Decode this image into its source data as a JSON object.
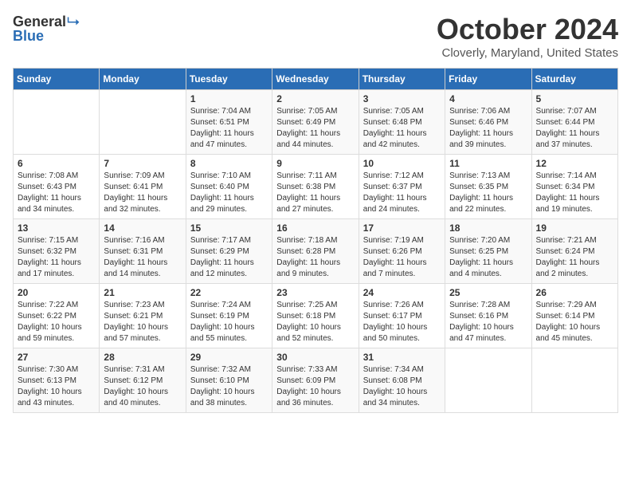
{
  "header": {
    "logo_general": "General",
    "logo_blue": "Blue",
    "month_title": "October 2024",
    "location": "Cloverly, Maryland, United States"
  },
  "weekdays": [
    "Sunday",
    "Monday",
    "Tuesday",
    "Wednesday",
    "Thursday",
    "Friday",
    "Saturday"
  ],
  "weeks": [
    [
      {
        "day": "",
        "sunrise": "",
        "sunset": "",
        "daylight": ""
      },
      {
        "day": "",
        "sunrise": "",
        "sunset": "",
        "daylight": ""
      },
      {
        "day": "1",
        "sunrise": "Sunrise: 7:04 AM",
        "sunset": "Sunset: 6:51 PM",
        "daylight": "Daylight: 11 hours and 47 minutes."
      },
      {
        "day": "2",
        "sunrise": "Sunrise: 7:05 AM",
        "sunset": "Sunset: 6:49 PM",
        "daylight": "Daylight: 11 hours and 44 minutes."
      },
      {
        "day": "3",
        "sunrise": "Sunrise: 7:05 AM",
        "sunset": "Sunset: 6:48 PM",
        "daylight": "Daylight: 11 hours and 42 minutes."
      },
      {
        "day": "4",
        "sunrise": "Sunrise: 7:06 AM",
        "sunset": "Sunset: 6:46 PM",
        "daylight": "Daylight: 11 hours and 39 minutes."
      },
      {
        "day": "5",
        "sunrise": "Sunrise: 7:07 AM",
        "sunset": "Sunset: 6:44 PM",
        "daylight": "Daylight: 11 hours and 37 minutes."
      }
    ],
    [
      {
        "day": "6",
        "sunrise": "Sunrise: 7:08 AM",
        "sunset": "Sunset: 6:43 PM",
        "daylight": "Daylight: 11 hours and 34 minutes."
      },
      {
        "day": "7",
        "sunrise": "Sunrise: 7:09 AM",
        "sunset": "Sunset: 6:41 PM",
        "daylight": "Daylight: 11 hours and 32 minutes."
      },
      {
        "day": "8",
        "sunrise": "Sunrise: 7:10 AM",
        "sunset": "Sunset: 6:40 PM",
        "daylight": "Daylight: 11 hours and 29 minutes."
      },
      {
        "day": "9",
        "sunrise": "Sunrise: 7:11 AM",
        "sunset": "Sunset: 6:38 PM",
        "daylight": "Daylight: 11 hours and 27 minutes."
      },
      {
        "day": "10",
        "sunrise": "Sunrise: 7:12 AM",
        "sunset": "Sunset: 6:37 PM",
        "daylight": "Daylight: 11 hours and 24 minutes."
      },
      {
        "day": "11",
        "sunrise": "Sunrise: 7:13 AM",
        "sunset": "Sunset: 6:35 PM",
        "daylight": "Daylight: 11 hours and 22 minutes."
      },
      {
        "day": "12",
        "sunrise": "Sunrise: 7:14 AM",
        "sunset": "Sunset: 6:34 PM",
        "daylight": "Daylight: 11 hours and 19 minutes."
      }
    ],
    [
      {
        "day": "13",
        "sunrise": "Sunrise: 7:15 AM",
        "sunset": "Sunset: 6:32 PM",
        "daylight": "Daylight: 11 hours and 17 minutes."
      },
      {
        "day": "14",
        "sunrise": "Sunrise: 7:16 AM",
        "sunset": "Sunset: 6:31 PM",
        "daylight": "Daylight: 11 hours and 14 minutes."
      },
      {
        "day": "15",
        "sunrise": "Sunrise: 7:17 AM",
        "sunset": "Sunset: 6:29 PM",
        "daylight": "Daylight: 11 hours and 12 minutes."
      },
      {
        "day": "16",
        "sunrise": "Sunrise: 7:18 AM",
        "sunset": "Sunset: 6:28 PM",
        "daylight": "Daylight: 11 hours and 9 minutes."
      },
      {
        "day": "17",
        "sunrise": "Sunrise: 7:19 AM",
        "sunset": "Sunset: 6:26 PM",
        "daylight": "Daylight: 11 hours and 7 minutes."
      },
      {
        "day": "18",
        "sunrise": "Sunrise: 7:20 AM",
        "sunset": "Sunset: 6:25 PM",
        "daylight": "Daylight: 11 hours and 4 minutes."
      },
      {
        "day": "19",
        "sunrise": "Sunrise: 7:21 AM",
        "sunset": "Sunset: 6:24 PM",
        "daylight": "Daylight: 11 hours and 2 minutes."
      }
    ],
    [
      {
        "day": "20",
        "sunrise": "Sunrise: 7:22 AM",
        "sunset": "Sunset: 6:22 PM",
        "daylight": "Daylight: 10 hours and 59 minutes."
      },
      {
        "day": "21",
        "sunrise": "Sunrise: 7:23 AM",
        "sunset": "Sunset: 6:21 PM",
        "daylight": "Daylight: 10 hours and 57 minutes."
      },
      {
        "day": "22",
        "sunrise": "Sunrise: 7:24 AM",
        "sunset": "Sunset: 6:19 PM",
        "daylight": "Daylight: 10 hours and 55 minutes."
      },
      {
        "day": "23",
        "sunrise": "Sunrise: 7:25 AM",
        "sunset": "Sunset: 6:18 PM",
        "daylight": "Daylight: 10 hours and 52 minutes."
      },
      {
        "day": "24",
        "sunrise": "Sunrise: 7:26 AM",
        "sunset": "Sunset: 6:17 PM",
        "daylight": "Daylight: 10 hours and 50 minutes."
      },
      {
        "day": "25",
        "sunrise": "Sunrise: 7:28 AM",
        "sunset": "Sunset: 6:16 PM",
        "daylight": "Daylight: 10 hours and 47 minutes."
      },
      {
        "day": "26",
        "sunrise": "Sunrise: 7:29 AM",
        "sunset": "Sunset: 6:14 PM",
        "daylight": "Daylight: 10 hours and 45 minutes."
      }
    ],
    [
      {
        "day": "27",
        "sunrise": "Sunrise: 7:30 AM",
        "sunset": "Sunset: 6:13 PM",
        "daylight": "Daylight: 10 hours and 43 minutes."
      },
      {
        "day": "28",
        "sunrise": "Sunrise: 7:31 AM",
        "sunset": "Sunset: 6:12 PM",
        "daylight": "Daylight: 10 hours and 40 minutes."
      },
      {
        "day": "29",
        "sunrise": "Sunrise: 7:32 AM",
        "sunset": "Sunset: 6:10 PM",
        "daylight": "Daylight: 10 hours and 38 minutes."
      },
      {
        "day": "30",
        "sunrise": "Sunrise: 7:33 AM",
        "sunset": "Sunset: 6:09 PM",
        "daylight": "Daylight: 10 hours and 36 minutes."
      },
      {
        "day": "31",
        "sunrise": "Sunrise: 7:34 AM",
        "sunset": "Sunset: 6:08 PM",
        "daylight": "Daylight: 10 hours and 34 minutes."
      },
      {
        "day": "",
        "sunrise": "",
        "sunset": "",
        "daylight": ""
      },
      {
        "day": "",
        "sunrise": "",
        "sunset": "",
        "daylight": ""
      }
    ]
  ]
}
